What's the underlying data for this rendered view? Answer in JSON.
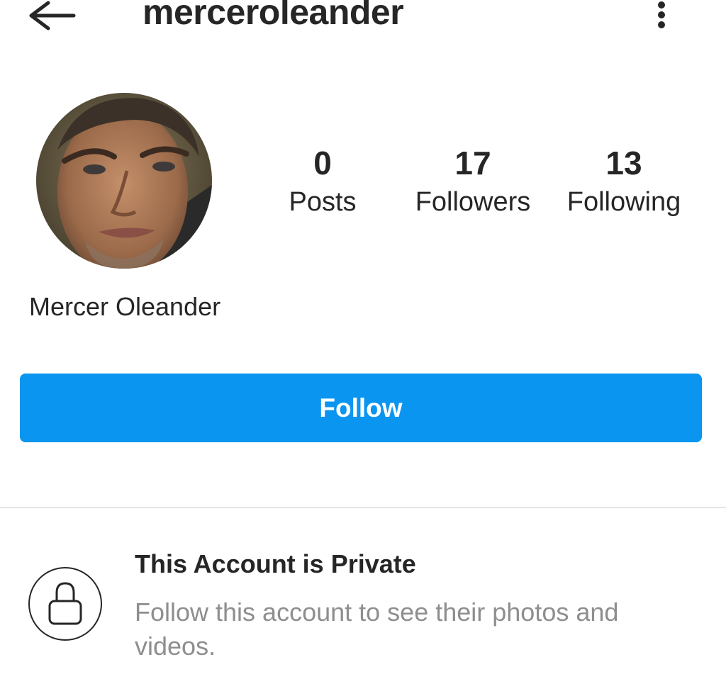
{
  "header": {
    "username": "merceroleander",
    "back_icon": "arrow-left-icon",
    "more_icon": "more-vertical-icon"
  },
  "profile": {
    "display_name": "Mercer Oleander",
    "avatar_icon": "profile-photo",
    "stats": {
      "posts": {
        "value": "0",
        "label": "Posts"
      },
      "followers": {
        "value": "17",
        "label": "Followers"
      },
      "following": {
        "value": "13",
        "label": "Following"
      }
    }
  },
  "follow_button": {
    "label": "Follow",
    "color": "#0a95f0"
  },
  "private_notice": {
    "icon": "lock-icon",
    "title": "This Account is Private",
    "description": "Follow this account to see their photos and videos."
  }
}
